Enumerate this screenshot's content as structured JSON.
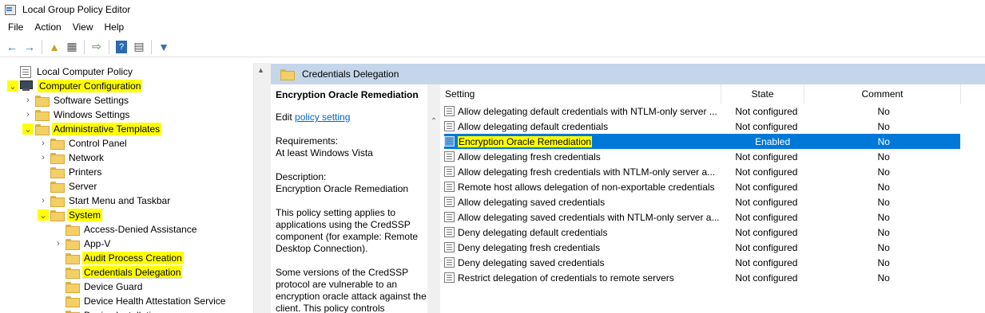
{
  "window": {
    "title": "Local Group Policy Editor"
  },
  "menu": [
    "File",
    "Action",
    "View",
    "Help"
  ],
  "toolbar": {
    "icons": [
      "back-arrow-icon",
      "forward-arrow-icon",
      "up-folder-icon",
      "show-hide-tree-icon",
      "export-list-icon",
      "help-icon",
      "properties-icon",
      "filter-icon"
    ]
  },
  "tree": [
    {
      "label": "Local Computer Policy",
      "icon": "doc",
      "indent": 0,
      "expander": ""
    },
    {
      "label": "Computer Configuration",
      "icon": "computer",
      "indent": 0,
      "expander": "v",
      "highlight": true
    },
    {
      "label": "Software Settings",
      "icon": "folder",
      "indent": 1,
      "expander": ">"
    },
    {
      "label": "Windows Settings",
      "icon": "folder",
      "indent": 1,
      "expander": ">"
    },
    {
      "label": "Administrative Templates",
      "icon": "folder",
      "indent": 1,
      "expander": "v",
      "highlight": true
    },
    {
      "label": "Control Panel",
      "icon": "folder",
      "indent": 2,
      "expander": ">"
    },
    {
      "label": "Network",
      "icon": "folder",
      "indent": 2,
      "expander": ">"
    },
    {
      "label": "Printers",
      "icon": "folder",
      "indent": 2,
      "expander": ""
    },
    {
      "label": "Server",
      "icon": "folder",
      "indent": 2,
      "expander": ""
    },
    {
      "label": "Start Menu and Taskbar",
      "icon": "folder",
      "indent": 2,
      "expander": ">"
    },
    {
      "label": "System",
      "icon": "folder",
      "indent": 2,
      "expander": "v",
      "highlight": true
    },
    {
      "label": "Access-Denied Assistance",
      "icon": "folder",
      "indent": 3,
      "expander": ""
    },
    {
      "label": "App-V",
      "icon": "folder",
      "indent": 3,
      "expander": ">"
    },
    {
      "label": "Audit Process Creation",
      "icon": "folder",
      "indent": 3,
      "expander": "",
      "highlight": true
    },
    {
      "label": "Credentials Delegation",
      "icon": "folder",
      "indent": 3,
      "expander": "",
      "highlight": true,
      "selected": true
    },
    {
      "label": "Device Guard",
      "icon": "folder",
      "indent": 3,
      "expander": ""
    },
    {
      "label": "Device Health Attestation Service",
      "icon": "folder",
      "indent": 3,
      "expander": ""
    },
    {
      "label": "Device Installation",
      "icon": "folder",
      "indent": 3,
      "expander": ">"
    }
  ],
  "right_header": {
    "title": "Credentials Delegation"
  },
  "description": {
    "title": "Encryption Oracle Remediation",
    "edit_prefix": "Edit ",
    "edit_link": "policy setting",
    "requirements_label": "Requirements:",
    "requirements_value": "At least Windows Vista",
    "description_label": "Description:",
    "description_value": "Encryption Oracle Remediation",
    "para1": "This policy setting applies to applications using the CredSSP component (for example: Remote Desktop Connection).",
    "para2": "Some versions of the CredSSP protocol are vulnerable to an encryption oracle attack against the client.  This policy controls"
  },
  "columns": {
    "setting": "Setting",
    "state": "State",
    "comment": "Comment"
  },
  "settings": [
    {
      "name": "Allow delegating default credentials with NTLM-only server ...",
      "state": "Not configured",
      "comment": "No"
    },
    {
      "name": "Allow delegating default credentials",
      "state": "Not configured",
      "comment": "No"
    },
    {
      "name": "Encryption Oracle Remediation",
      "state": "Enabled",
      "comment": "No",
      "selected": true
    },
    {
      "name": "Allow delegating fresh credentials",
      "state": "Not configured",
      "comment": "No"
    },
    {
      "name": "Allow delegating fresh credentials with NTLM-only server a...",
      "state": "Not configured",
      "comment": "No"
    },
    {
      "name": "Remote host allows delegation of non-exportable credentials",
      "state": "Not configured",
      "comment": "No"
    },
    {
      "name": "Allow delegating saved credentials",
      "state": "Not configured",
      "comment": "No"
    },
    {
      "name": "Allow delegating saved credentials with NTLM-only server a...",
      "state": "Not configured",
      "comment": "No"
    },
    {
      "name": "Deny delegating default credentials",
      "state": "Not configured",
      "comment": "No"
    },
    {
      "name": "Deny delegating fresh credentials",
      "state": "Not configured",
      "comment": "No"
    },
    {
      "name": "Deny delegating saved credentials",
      "state": "Not configured",
      "comment": "No"
    },
    {
      "name": "Restrict delegation of credentials to remote servers",
      "state": "Not configured",
      "comment": "No"
    }
  ],
  "colors": {
    "selection_blue": "#0078d7",
    "highlight_yellow": "#ffff00",
    "header_blue": "#c5d6ea",
    "folder_yellow": "#f3cf66"
  }
}
